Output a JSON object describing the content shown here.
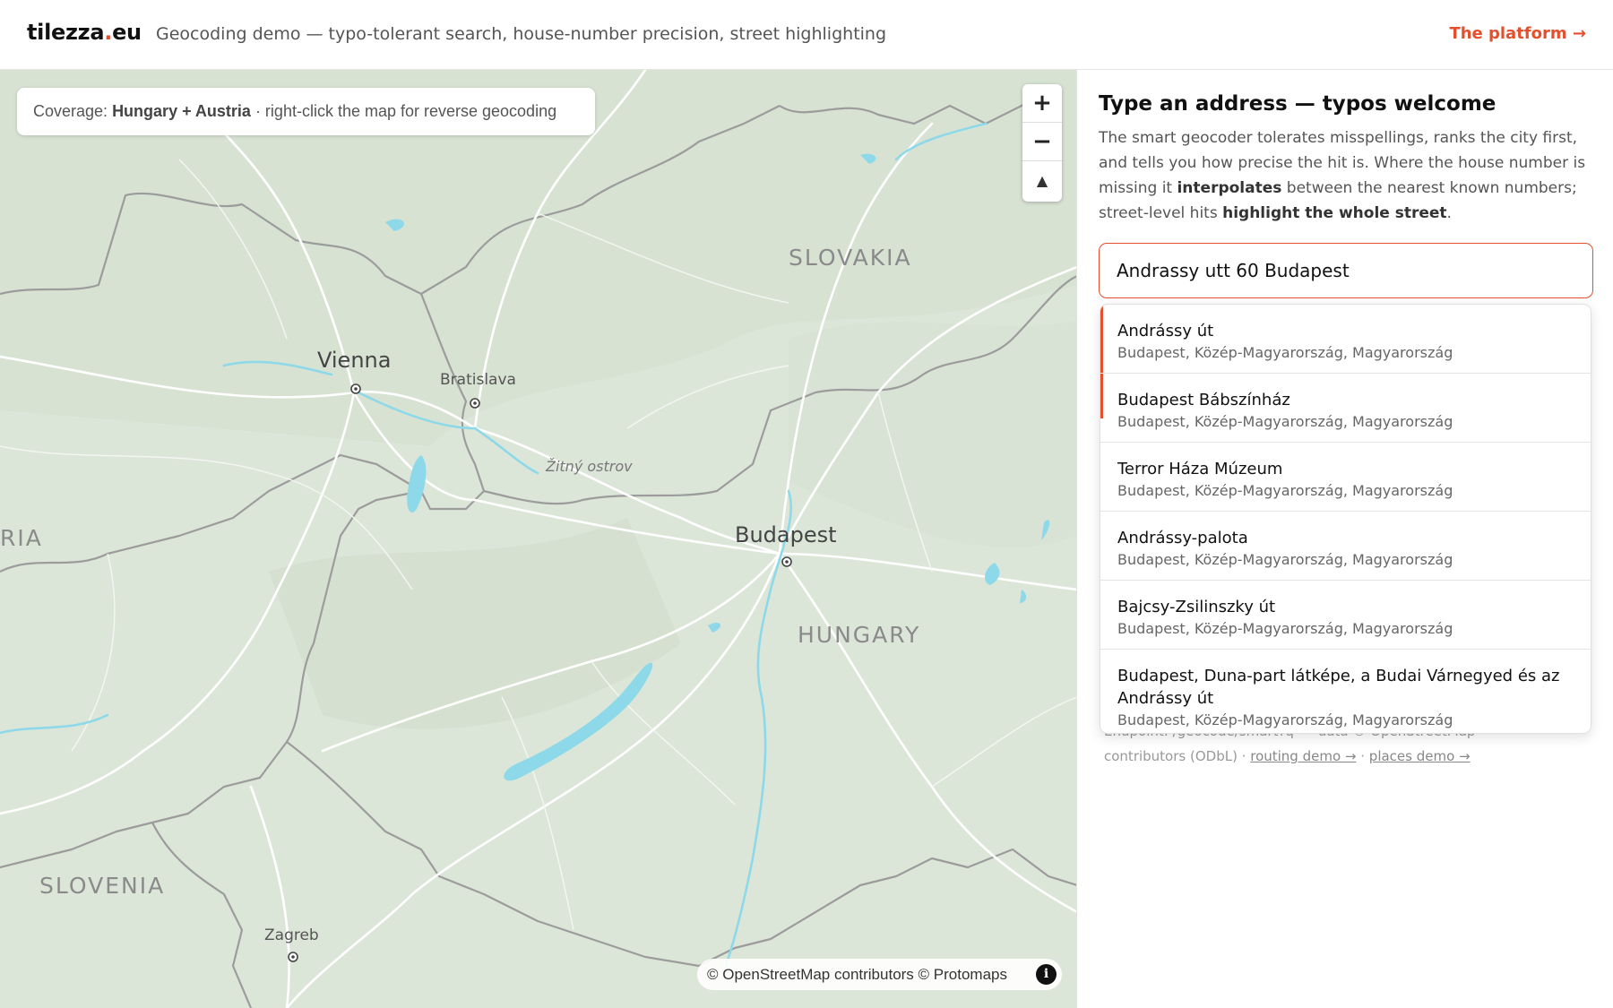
{
  "header": {
    "logo_pre": "tilezza",
    "logo_dot": ".",
    "logo_post": "eu",
    "tagline": "Geocoding demo — typo-tolerant search, house-number precision, street highlighting",
    "platform_link": "The platform →"
  },
  "map": {
    "coverage_prefix": "Coverage: ",
    "coverage_bold": "Hungary + Austria",
    "coverage_suffix": " · right-click the map for reverse geocoding",
    "zoom_in": "+",
    "zoom_out": "−",
    "compass": "▲",
    "attribution": "© OpenStreetMap contributors © Protomaps",
    "info": "i",
    "labels": {
      "slovakia": "SLOVAKIA",
      "hungary": "HUNGARY",
      "slovenia": "SLOVENIA",
      "austria_partial": "RIA",
      "vienna": "Vienna",
      "bratislava": "Bratislava",
      "budapest": "Budapest",
      "zagreb": "Zagreb",
      "zitny": "Žitný ostrov"
    },
    "colors": {
      "land": "#dde7d9",
      "water": "#8ed9e9",
      "border": "#9a9a9a",
      "road": "#ffffff"
    }
  },
  "panel": {
    "title": "Type an address — typos welcome",
    "desc_1": "The smart geocoder tolerates misspellings, ranks the city first, and tells you how precise the hit is. Where the house number is missing it ",
    "desc_b1": "interpolates",
    "desc_2": " between the nearest known numbers; street-level hits ",
    "desc_b2": "highlight the whole street",
    "desc_3": ".",
    "search_value": "Andrassy utt 60 Budapest",
    "footer_1": "Endpoint: /geocode/smart?q= · data © OpenStreetMap contributors (ODbL) · ",
    "routing_link": "routing demo →",
    "sep": " · ",
    "places_link": "places demo →"
  },
  "suggestions": [
    {
      "name": "Andrássy út",
      "sub": "Budapest, Közép-Magyarország, Magyarország"
    },
    {
      "name": "Budapest Bábszínház",
      "sub": "Budapest, Közép-Magyarország, Magyarország"
    },
    {
      "name": "Terror Háza Múzeum",
      "sub": "Budapest, Közép-Magyarország, Magyarország"
    },
    {
      "name": "Andrássy-palota",
      "sub": "Budapest, Közép-Magyarország, Magyarország"
    },
    {
      "name": "Bajcsy-Zsilinszky út",
      "sub": "Budapest, Közép-Magyarország, Magyarország"
    },
    {
      "name": "Budapest, Duna-part látképe, a Budai Várnegyed és az Andrássy út",
      "sub": "Budapest, Közép-Magyarország, Magyarország"
    }
  ]
}
